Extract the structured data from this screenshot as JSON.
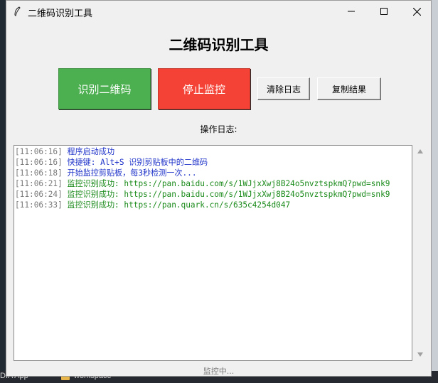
{
  "window": {
    "title": "二维码识别工具"
  },
  "heading": "二维码识别工具",
  "buttons": {
    "scan": "识别二维码",
    "stop": "停止监控",
    "clear_log": "清除日志",
    "copy_result": "复制结果"
  },
  "log_label": "操作日志:",
  "log": [
    {
      "time": "[11:06:16]",
      "text": "程序启动成功",
      "color": "#1f33c9"
    },
    {
      "time": "[11:06:16]",
      "text": "快捷键: Alt+S 识别剪贴板中的二维码",
      "color": "#1f33c9"
    },
    {
      "time": "[11:06:18]",
      "text": "开始监控剪贴板，每3秒检测一次...",
      "color": "#1f33c9"
    },
    {
      "time": "[11:06:21]",
      "text": "监控识别成功: https://pan.baidu.com/s/1WJjxXwj8B24o5nvztspkmQ?pwd=snk9",
      "color": "#1a8a1a"
    },
    {
      "time": "[11:06:24]",
      "text": "监控识别成功: https://pan.baidu.com/s/1WJjxXwj8B24o5nvztspkmQ?pwd=snk9",
      "color": "#1a8a1a"
    },
    {
      "time": "[11:06:33]",
      "text": "监控识别成功: https://pan.quark.cn/s/635c4254d047",
      "color": "#1a8a1a"
    }
  ],
  "status": "监控中...",
  "taskbar": {
    "left_item": "DIA App",
    "workspace": "workspace"
  },
  "colors": {
    "scan_button": "#4caf50",
    "stop_button": "#f44336"
  }
}
